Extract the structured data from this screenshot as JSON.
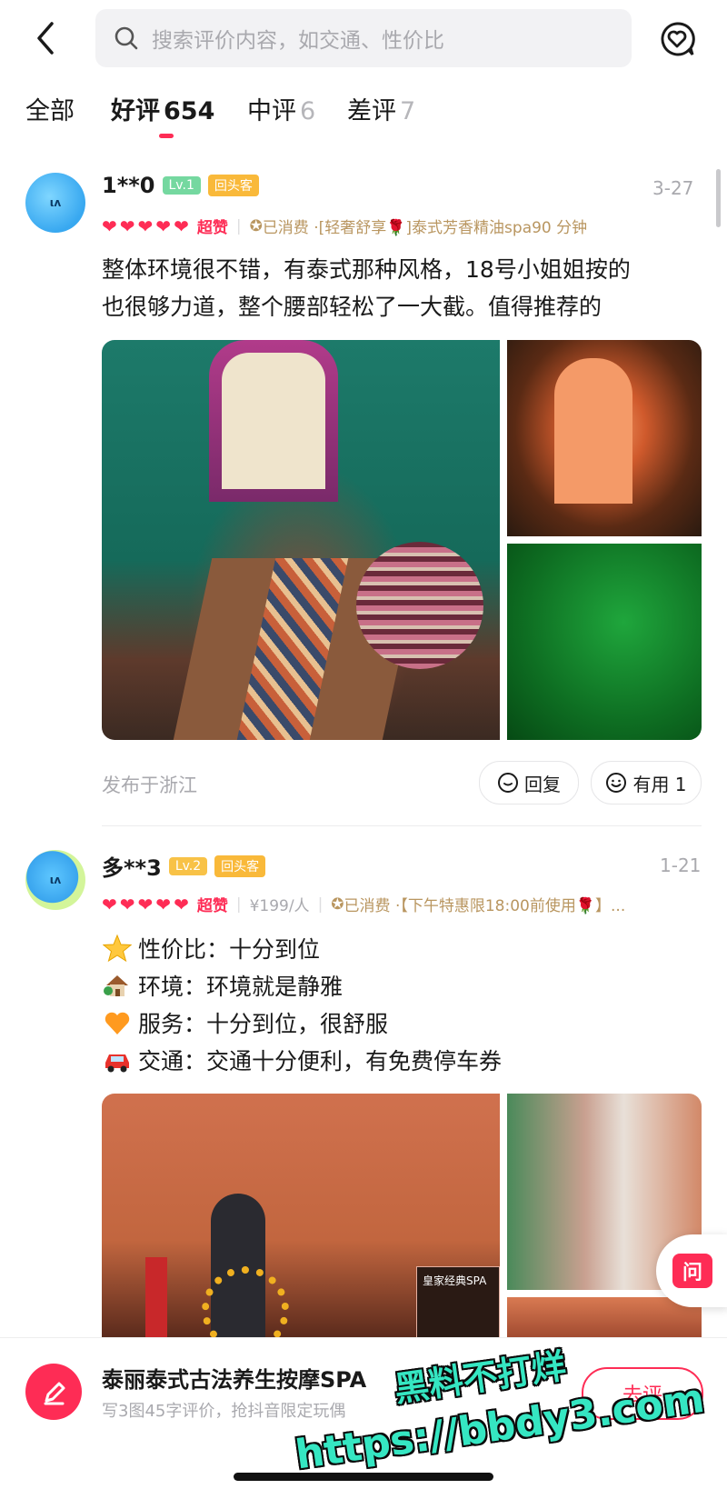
{
  "search": {
    "placeholder": "搜索评价内容，如交通、性价比"
  },
  "tabs": [
    {
      "label": "全部",
      "count": ""
    },
    {
      "label": "好评",
      "count": "654"
    },
    {
      "label": "中评",
      "count": "6"
    },
    {
      "label": "差评",
      "count": "7"
    }
  ],
  "reviews": [
    {
      "user": "1**0",
      "level": "Lv.1",
      "tag": "回头客",
      "date": "3-27",
      "hearts": 5,
      "rating_label": "超赞",
      "consumed": "已消费 ·[轻奢舒享🌹]泰式芳香精油spa90 分钟",
      "text_line1": "整体环境很不错，有泰式那种风格，18号小姐姐按的",
      "text_line2": "也很够力道，整个腰部轻松了一大截。值得推荐的",
      "location": "发布于浙江",
      "reply_label": "回复",
      "useful_label": "有用 1"
    },
    {
      "user": "多**3",
      "level": "Lv.2",
      "tag": "回头客",
      "date": "1-21",
      "hearts": 5,
      "rating_label": "超赞",
      "price": "¥199/人",
      "consumed": "已消费 ·【下午特惠限18:00前使用🌹】...",
      "items": [
        {
          "icon": "star-icon",
          "text": "性价比：十分到位"
        },
        {
          "icon": "house-icon",
          "text": "环境：环境就是静雅"
        },
        {
          "icon": "heart-icon",
          "text": "服务：十分到位，很舒服"
        },
        {
          "icon": "car-icon",
          "text": "交通：交通十分便利，有免费停车券"
        }
      ],
      "poster_title": "皇家经典SPA"
    }
  ],
  "ask_label": "问",
  "bottom": {
    "shop_name": "泰丽泰式古法养生按摩SPA",
    "sub": "写3图45字评价，抢抖音限定玩偶",
    "go_label": "去评"
  },
  "watermark": {
    "line1": "黑料不打烊",
    "line2": "https://bbdy3.com"
  },
  "colors": {
    "accent": "#fe2c55",
    "consumed": "#b99660",
    "watermark": "#35e6c2"
  }
}
